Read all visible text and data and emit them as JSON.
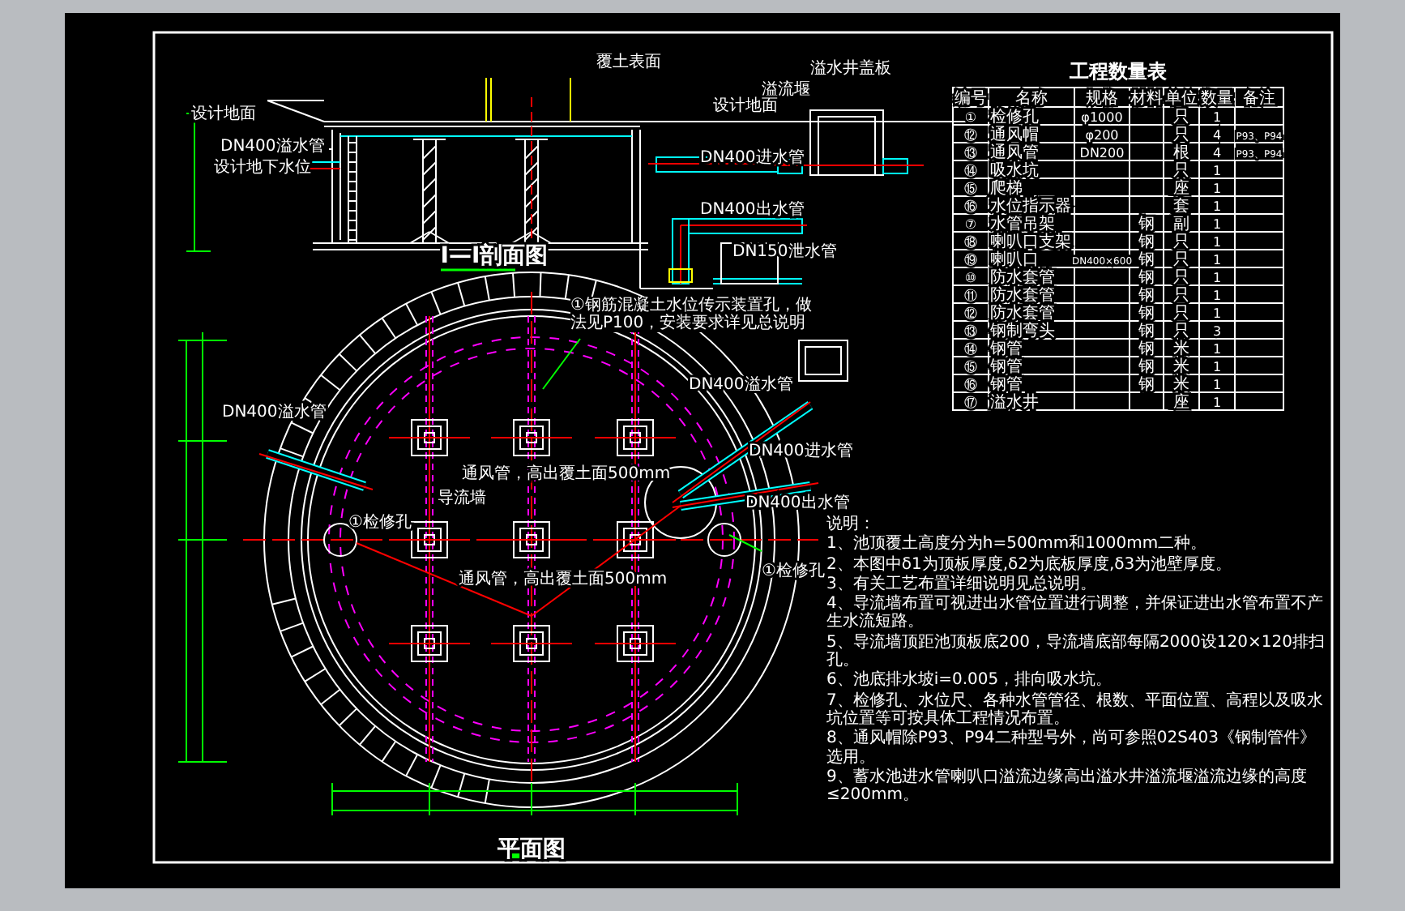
{
  "section_view": {
    "title": "I—I剖面图",
    "labels": [
      "设计地面",
      "DN400溢水管",
      "设计地下水位",
      "覆土表面",
      "溢流堰",
      "溢水井盖板",
      "设计地面",
      "DN400进水管",
      "DN400出水管",
      "DN150泄水管"
    ]
  },
  "plan_view": {
    "title": "平面图",
    "callout": "①钢筋混凝土水位传示装置孔，做法见P100，安装要求详见总说明",
    "labels": [
      "DN400溢水管",
      "DN400溢水管",
      "DN400进水管",
      "通风管，高出覆土面500mm",
      "导流墙",
      "DN400出水管",
      "①检修孔",
      "①检修孔",
      "通风管，高出覆土面500mm"
    ]
  },
  "quantity_table": {
    "title": "工程数量表",
    "columns": [
      "编号",
      "名称",
      "规格",
      "材料",
      "单位",
      "数量",
      "备注"
    ],
    "rows": [
      [
        "①",
        "检修孔",
        "φ1000",
        "",
        "只",
        "1",
        ""
      ],
      [
        "⑫",
        "通风帽",
        "φ200",
        "",
        "只",
        "4",
        "P93、P94"
      ],
      [
        "⑬",
        "通风管",
        "DN200",
        "",
        "根",
        "4",
        "P93、P94"
      ],
      [
        "⑭",
        "吸水坑",
        "",
        "",
        "只",
        "1",
        ""
      ],
      [
        "⑮",
        "爬梯",
        "",
        "",
        "座",
        "1",
        ""
      ],
      [
        "⑯",
        "水位指示器",
        "",
        "",
        "套",
        "1",
        ""
      ],
      [
        "⑦",
        "水管吊架",
        "",
        "钢",
        "副",
        "1",
        ""
      ],
      [
        "⑱",
        "喇叭口支架",
        "",
        "钢",
        "只",
        "1",
        ""
      ],
      [
        "⑲",
        "喇叭口",
        "DN400×600",
        "钢",
        "只",
        "1",
        ""
      ],
      [
        "⑩",
        "防水套管",
        "",
        "钢",
        "只",
        "1",
        ""
      ],
      [
        "⑪",
        "防水套管",
        "",
        "钢",
        "只",
        "1",
        ""
      ],
      [
        "⑫",
        "防水套管",
        "",
        "钢",
        "只",
        "1",
        ""
      ],
      [
        "⑬",
        "钢制弯头",
        "",
        "钢",
        "只",
        "3",
        ""
      ],
      [
        "⑭",
        "钢管",
        "",
        "钢",
        "米",
        "1",
        ""
      ],
      [
        "⑮",
        "钢管",
        "",
        "钢",
        "米",
        "1",
        ""
      ],
      [
        "⑯",
        "钢管",
        "",
        "钢",
        "米",
        "1",
        ""
      ],
      [
        "⑰",
        "溢水井",
        "",
        "",
        "座",
        "1",
        ""
      ]
    ]
  },
  "notes": {
    "heading": "说明：",
    "items": [
      "1、池顶覆土高度分为h=500mm和1000mm二种。",
      "2、本图中δ1为顶板厚度,δ2为底板厚度,δ3为池壁厚度。",
      "3、有关工艺布置详细说明见总说明。",
      "4、导流墙布置可视进出水管位置进行调整，并保证进出水管布置不产生水流短路。",
      "5、导流墙顶距池顶板底200，导流墙底部每隔2000设120×120排扫孔。",
      "6、池底排水坡i=0.005，排向吸水坑。",
      "7、检修孔、水位尺、各种水管管径、根数、平面位置、高程以及吸水坑位置等可按具体工程情况布置。",
      "8、通风帽除P93、P94二种型号外，尚可参照02S403《钢制管件》选用。",
      "9、蓄水池进水管喇叭口溢流边缘高出溢水井溢流堰溢流边缘的高度≤200mm。"
    ]
  }
}
